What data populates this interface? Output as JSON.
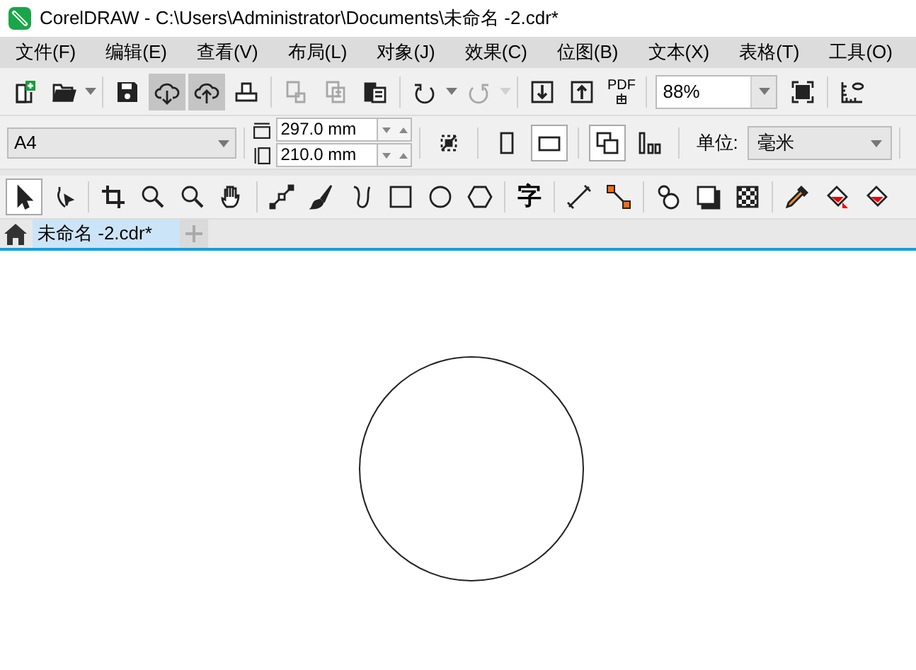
{
  "window": {
    "title": "CorelDRAW - C:\\Users\\Administrator\\Documents\\未命名 -2.cdr*"
  },
  "menu": [
    "文件(F)",
    "编辑(E)",
    "查看(V)",
    "布局(L)",
    "对象(J)",
    "效果(C)",
    "位图(B)",
    "文本(X)",
    "表格(T)",
    "工具(O)"
  ],
  "standard_toolbar": [
    {
      "kind": "new",
      "pressed": false,
      "disabled": false
    },
    {
      "kind": "open",
      "pressed": false,
      "disabled": false,
      "dropdown": true
    },
    {
      "kind": "sep"
    },
    {
      "kind": "save",
      "pressed": false,
      "disabled": false
    },
    {
      "kind": "cloud-down",
      "pressed": true,
      "disabled": false
    },
    {
      "kind": "cloud-up",
      "pressed": true,
      "disabled": false
    },
    {
      "kind": "print",
      "pressed": false,
      "disabled": false
    },
    {
      "kind": "sep"
    },
    {
      "kind": "cut",
      "pressed": false,
      "disabled": true
    },
    {
      "kind": "copy",
      "pressed": false,
      "disabled": true
    },
    {
      "kind": "paste",
      "pressed": false,
      "disabled": false
    },
    {
      "kind": "sep"
    },
    {
      "kind": "undo",
      "pressed": false,
      "disabled": false,
      "dropdown": true
    },
    {
      "kind": "redo",
      "pressed": false,
      "disabled": true,
      "dropdown": true
    },
    {
      "kind": "sep"
    },
    {
      "kind": "import",
      "pressed": false,
      "disabled": false
    },
    {
      "kind": "export",
      "pressed": false,
      "disabled": false
    },
    {
      "kind": "pdf",
      "label": "PDF",
      "pressed": false,
      "disabled": false
    },
    {
      "kind": "sep"
    },
    {
      "kind": "zoom",
      "value": "88%"
    },
    {
      "kind": "fullscreen",
      "pressed": false,
      "disabled": false
    },
    {
      "kind": "sep"
    },
    {
      "kind": "ruler",
      "pressed": false,
      "disabled": false
    }
  ],
  "property_bar": {
    "page_size": "A4",
    "width": "297.0 mm",
    "height": "210.0 mm",
    "orientation": [
      {
        "kind": "portrait",
        "selected": false
      },
      {
        "kind": "landscape",
        "selected": true
      }
    ],
    "page_buttons": [
      {
        "kind": "all-pages",
        "selected": true
      },
      {
        "kind": "current-page",
        "selected": false
      }
    ],
    "units_label": "单位:",
    "units": "毫米"
  },
  "toolbox": [
    {
      "kind": "pick",
      "selected": true
    },
    {
      "kind": "shape",
      "selected": false
    },
    {
      "kind": "sep"
    },
    {
      "kind": "crop",
      "selected": false
    },
    {
      "kind": "zoom",
      "selected": false
    },
    {
      "kind": "zoom2",
      "selected": false
    },
    {
      "kind": "pan",
      "selected": false
    },
    {
      "kind": "sep"
    },
    {
      "kind": "line",
      "selected": false
    },
    {
      "kind": "brush",
      "selected": false
    },
    {
      "kind": "smart",
      "selected": false
    },
    {
      "kind": "rect",
      "selected": false
    },
    {
      "kind": "ellipse",
      "selected": false
    },
    {
      "kind": "polygon",
      "selected": false
    },
    {
      "kind": "sep"
    },
    {
      "kind": "text",
      "label": "字",
      "selected": false
    },
    {
      "kind": "sep"
    },
    {
      "kind": "dimension",
      "selected": false
    },
    {
      "kind": "connector",
      "selected": false
    },
    {
      "kind": "sep"
    },
    {
      "kind": "blend",
      "selected": false
    },
    {
      "kind": "shadow",
      "selected": false
    },
    {
      "kind": "transparency",
      "selected": false
    },
    {
      "kind": "sep"
    },
    {
      "kind": "eyedropper",
      "selected": false
    },
    {
      "kind": "fill",
      "selected": false
    },
    {
      "kind": "smartfill",
      "selected": false
    }
  ],
  "tabs": [
    {
      "label": "未命名 -2.cdr*",
      "selected": true
    }
  ]
}
